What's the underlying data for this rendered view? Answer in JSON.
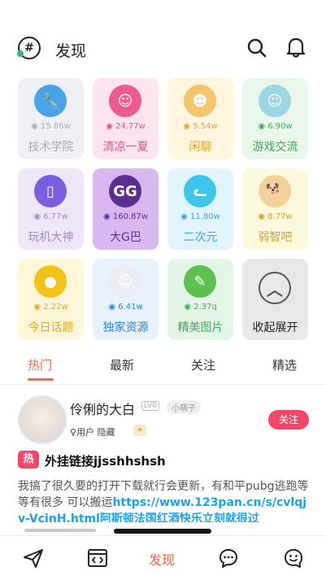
{
  "header": {
    "title": "发现",
    "logo_icon": "topic-hash-icon",
    "search_icon": "search-icon",
    "bell_icon": "bell-icon"
  },
  "colors": {
    "accent": "#f0664a",
    "follow": "#f2466b",
    "link": "#1ba3e8"
  },
  "categories": [
    {
      "name": "技术学院",
      "count": "15.86w",
      "icon": "wrench-icon",
      "bg": "#eef0f4",
      "iconbg": "#4aa3e6",
      "text": "#a8adb6"
    },
    {
      "name": "清凉一夏",
      "count": "24.77w",
      "icon": "girl-avatar-icon",
      "bg": "#fde4ee",
      "iconbg": "#ee5a92",
      "text": "#e0528a"
    },
    {
      "name": "闲聊",
      "count": "5.54w",
      "icon": "chat-character-icon",
      "bg": "#fff6dd",
      "iconbg": "#f3c46a",
      "text": "#e0a42a"
    },
    {
      "name": "游戏交流",
      "count": "6.90w",
      "icon": "game-character-icon",
      "bg": "#e8f7ea",
      "iconbg": "#9ad6e4",
      "text": "#3aab5a"
    },
    {
      "name": "玩机大神",
      "count": "6.77w",
      "icon": "phone-icon",
      "bg": "#efe6f8",
      "iconbg": "#7b5ee0",
      "text": "#a08ac8"
    },
    {
      "name": "大G巴",
      "count": "160.87w",
      "icon": "gg-logo-icon",
      "bg": "#d9b7ef",
      "iconbg": "#5d2d90",
      "text": "#5d2d90"
    },
    {
      "name": "二次元",
      "count": "11.80w",
      "icon": "cat-face-icon",
      "bg": "#e2f4fb",
      "iconbg": "#3cc6ee",
      "text": "#37a7d6"
    },
    {
      "name": "弱智吧",
      "count": "8.77w",
      "icon": "shiba-dog-icon",
      "bg": "#fbf8dc",
      "iconbg": "#f3d29a",
      "text": "#c9a530"
    },
    {
      "name": "今日话题",
      "count": "2.22w",
      "icon": "person-topic-icon",
      "bg": "#fff7d8",
      "iconbg": "#f2c214",
      "text": "#e2a91a"
    },
    {
      "name": "独家资源",
      "count": "6.41w",
      "icon": "meme-face-icon",
      "bg": "#e6f1fb",
      "iconbg": "#e9edf2",
      "text": "#2d84cc"
    },
    {
      "name": "精美图片",
      "count": "2.37q",
      "icon": "brush-icon",
      "bg": "#e3f5e6",
      "iconbg": "#5ec04e",
      "text": "#3aab5a"
    },
    {
      "name": "收起展开",
      "count": "",
      "icon": "chevron-up-circle-icon",
      "bg": "#e8e8e8",
      "iconbg": "#e8e8e8",
      "text": "#222222"
    }
  ],
  "tabs": [
    "热门",
    "最新",
    "关注",
    "精选"
  ],
  "post": {
    "username": "伶俐的大白",
    "level": "LV0",
    "badge": "小萌子",
    "meta": "用户 隐藏",
    "follow_label": "关注",
    "hot_label": "热",
    "title": "外挂链接jjsshhshsh",
    "body_text": "我搞了很久要的打开下载就行会更新，有和平pubg逃跑等等有很多   可以搬运",
    "body_link": "https://www.123pan.cn/s/cvlqjv-VcjnH.html阿斯顿法国红酒快乐立刻就很过"
  },
  "bottom_nav": [
    {
      "icon": "send-icon",
      "label": ""
    },
    {
      "icon": "code-window-icon",
      "label": ""
    },
    {
      "icon": "",
      "label": "发现"
    },
    {
      "icon": "chat-bubble-icon",
      "label": ""
    },
    {
      "icon": "smile-face-icon",
      "label": ""
    }
  ]
}
